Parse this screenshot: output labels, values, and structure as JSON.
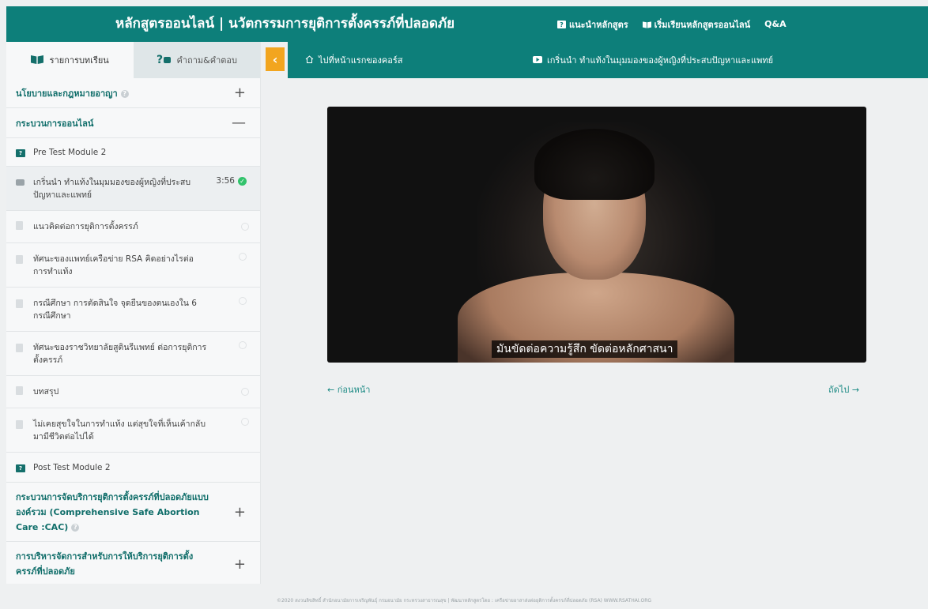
{
  "header": {
    "title": "หลักสูตรออนไลน์ | นวัตกรรมการยุติการตั้งครรภ์ที่ปลอดภัย",
    "nav": [
      {
        "label": "แนะนำหลักสูตร",
        "icon": "help-box-icon"
      },
      {
        "label": "เริ่มเรียนหลักสูตรออนไลน์",
        "icon": "book-icon"
      },
      {
        "label": "Q&A",
        "icon": ""
      }
    ]
  },
  "sidebar": {
    "tabs": [
      {
        "label": "รายการบทเรียน",
        "icon": "book-icon"
      },
      {
        "label": "คำถาม&คำตอบ",
        "icon": "question-icon"
      }
    ],
    "sections": [
      {
        "title": "นโยบายและกฎหมายอาญา",
        "sign": "+"
      },
      {
        "title": "กระบวนการออนไลน์",
        "sign": "—"
      }
    ],
    "lessons": [
      {
        "label": "Pre Test Module 2",
        "type": "quiz"
      },
      {
        "label": "เกริ่นนำ ทำแท้งในมุมมองของผู้หญิงที่ประสบปัญหาและแพทย์",
        "type": "video",
        "duration": "3:56",
        "done": true
      },
      {
        "label": "แนวคิดต่อการยุติการตั้งครรภ์",
        "type": "doc"
      },
      {
        "label": "ทัศนะของแพทย์เครือข่าย RSA คิดอย่างไรต่อการทำแท้ง",
        "type": "doc"
      },
      {
        "label": "กรณีศึกษา การตัดสินใจ จุดยืนของตนเองใน 6 กรณีศึกษา",
        "type": "doc"
      },
      {
        "label": "ทัศนะของราชวิทยาลัยสูตินรีแพทย์ ต่อการยุติการตั้งครรภ์",
        "type": "doc"
      },
      {
        "label": "บทสรุป",
        "type": "doc"
      },
      {
        "label": "ไม่เคยสุขใจในการทำแท้ง แต่สุขใจที่เห็นเค้ากลับมามีชีวิตต่อไปได้",
        "type": "doc"
      },
      {
        "label": "Post Test Module 2",
        "type": "quiz"
      }
    ],
    "more_sections": [
      {
        "title": "กระบวนการจัดบริการยุติการตั้งครรภ์ที่ปลอดภัยแบบองค์รวม (Comprehensive Safe Abortion Care :CAC)",
        "sign": "+"
      },
      {
        "title": "การบริหารจัดการสำหรับการให้บริการยุติการตั้งครรภ์ที่ปลอดภัย",
        "sign": "+"
      }
    ]
  },
  "subbar": {
    "home_label": "ไปที่หน้าแรกของคอร์ส",
    "current_lesson": "เกริ่นนำ ทำแท้งในมุมมองของผู้หญิงที่ประสบปัญหาและแพทย์"
  },
  "player": {
    "subtitle": "มันขัดต่อความรู้สึก ขัดต่อหลักศาสนา"
  },
  "pager": {
    "prev": "← ก่อนหน้า",
    "next": "ถัดไป →"
  },
  "footer": {
    "text": "©2020 สงวนลิขสิทธิ์ สำนักอนามัยการเจริญพันธุ์ กรมอนามัย กระทรวงสาธารณสุข | พัฒนาหลักสูตรโดย : เครือข่ายอาสาส่งต่อยุติการตั้งครรภ์ที่ปลอดภัย (RSA) WWW.RSATHAI.ORG"
  },
  "colors": {
    "brand": "#0d7f7a",
    "accent": "#f2a51f",
    "done": "#32c36c"
  }
}
